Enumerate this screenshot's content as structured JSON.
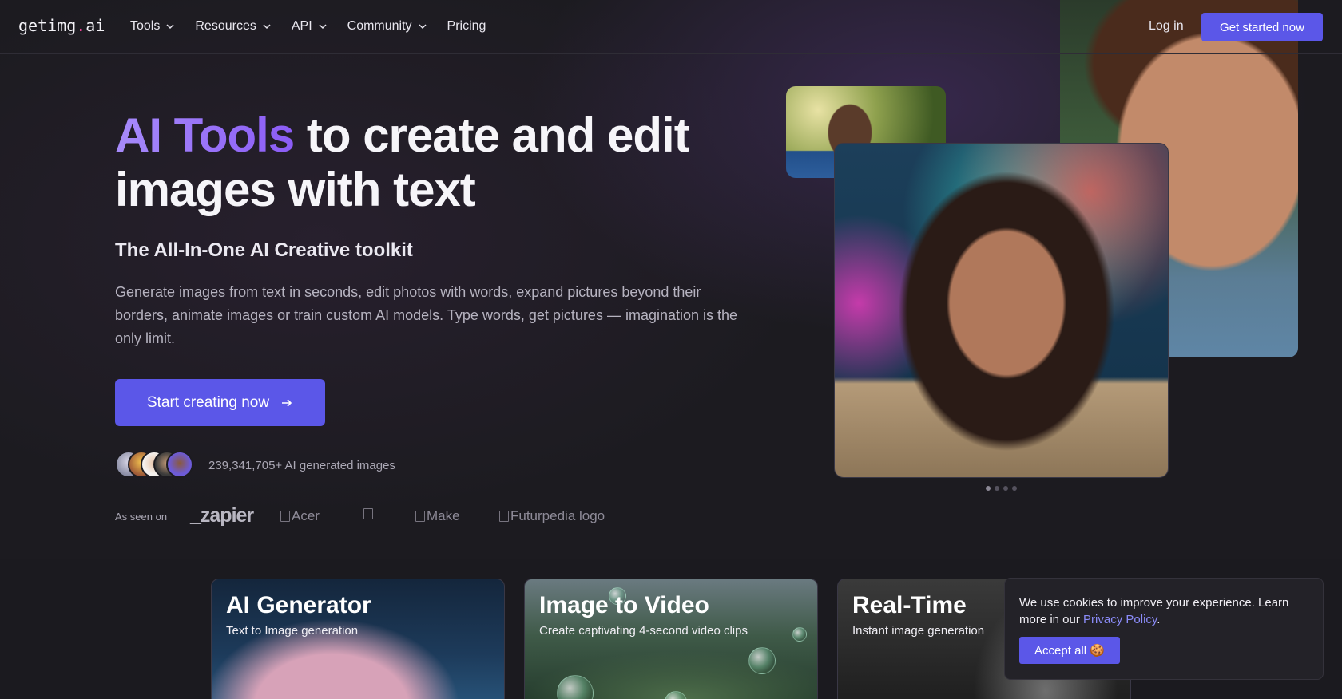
{
  "nav": {
    "logo_prefix": "getimg",
    "logo_dot": ".",
    "logo_suffix": "ai",
    "items": [
      {
        "label": "Tools",
        "has_dropdown": true
      },
      {
        "label": "Resources",
        "has_dropdown": true
      },
      {
        "label": "API",
        "has_dropdown": true
      },
      {
        "label": "Community",
        "has_dropdown": true
      },
      {
        "label": "Pricing",
        "has_dropdown": false
      }
    ],
    "login_label": "Log in",
    "get_started_label": "Get started now"
  },
  "hero": {
    "title_accent": "AI Tools",
    "title_rest": " to create and edit images with text",
    "subtitle": "The All-In-One AI Creative toolkit",
    "description": "Generate images from text in seconds, edit photos with words, expand pictures beyond their borders, animate images or train custom AI models. Type words, get pictures — imagination is the only limit.",
    "cta_label": "Start creating now",
    "generated_count": "239,341,705+ AI generated images",
    "as_seen_on_label": "As seen on",
    "brands": [
      "_zapier",
      "Acer",
      "",
      "Make",
      "Futurpedia logo"
    ],
    "carousel_slides": 4,
    "carousel_active": 0
  },
  "tools": [
    {
      "title": "AI Generator",
      "subtitle": "Text to Image generation"
    },
    {
      "title": "Image to Video",
      "subtitle": "Create captivating 4-second video clips"
    },
    {
      "title": "Real-Time",
      "subtitle": "Instant image generation"
    }
  ],
  "cookie": {
    "text": "We use cookies to improve your experience. Learn more in our ",
    "link": "Privacy Policy",
    "end": ".",
    "accept_label": "Accept all 🍪"
  },
  "colors": {
    "accent": "#5b57e8",
    "gradient_start": "#a78bfa",
    "gradient_end": "#8b5cf6",
    "background": "#1c1b20"
  }
}
